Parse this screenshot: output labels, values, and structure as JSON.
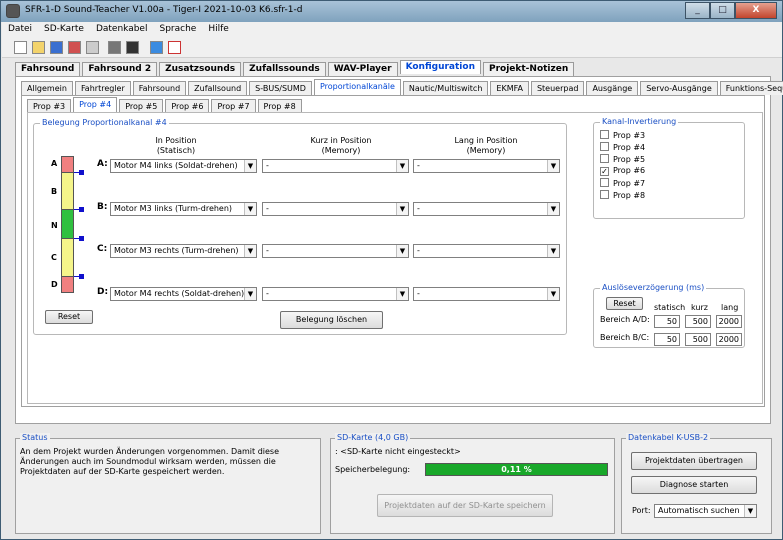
{
  "window": {
    "title": "SFR-1-D Sound-Teacher V1.00a - Tiger-I 2021-10-03 K6.sfr-1-d",
    "controls": [
      "_",
      "□",
      "X"
    ]
  },
  "menu": [
    "Datei",
    "SD-Karte",
    "Datenkabel",
    "Sprache",
    "Hilfe"
  ],
  "main_tabs": [
    "Fahrsound",
    "Fahrsound 2",
    "Zusatzsounds",
    "Zufallssounds",
    "WAV-Player",
    "Konfiguration",
    "Projekt-Notizen"
  ],
  "main_tab_selected": 5,
  "sub_tabs": [
    "Allgemein",
    "Fahrtregler",
    "Fahrsound",
    "Zufallsound",
    "S-BUS/SUMD",
    "Proportionalkanäle",
    "Nautic/Multiswitch",
    "EKMFA",
    "Steuerpad",
    "Ausgänge",
    "Servo-Ausgänge",
    "Funktions-Sequenzen"
  ],
  "sub_tab_selected": 5,
  "prop_tabs": [
    "Prop #3",
    "Prop #4",
    "Prop #5",
    "Prop #6",
    "Prop #7",
    "Prop #8"
  ],
  "prop_tab_selected": 1,
  "belegung": {
    "title": "Belegung Proportionalkanal #4",
    "col_in_position": [
      "In Position",
      "(Statisch)"
    ],
    "col_kurz": [
      "Kurz in Position",
      "(Memory)"
    ],
    "col_lang": [
      "Lang in Position",
      "(Memory)"
    ],
    "rows": [
      {
        "label": "A:",
        "in_position": "Motor M4 links (Soldat-drehen)",
        "kurz": "-",
        "lang": "-"
      },
      {
        "label": "B:",
        "in_position": "Motor M3 links (Turm-drehen)",
        "kurz": "-",
        "lang": "-"
      },
      {
        "label": "C:",
        "in_position": "Motor M3 rechts (Turm-drehen)",
        "kurz": "-",
        "lang": "-"
      },
      {
        "label": "D:",
        "in_position": "Motor M4 rechts (Soldat-drehen)",
        "kurz": "-",
        "lang": "-"
      }
    ],
    "diagram_labels": [
      "A",
      "B",
      "N",
      "C",
      "D"
    ],
    "reset_label": "Reset",
    "clear_label": "Belegung löschen",
    "colors": {
      "red": "#f08080",
      "yellow": "#f5f58a",
      "green": "#30c040",
      "blue": "#1010cc"
    }
  },
  "kanal_invertierung": {
    "title": "Kanal-Invertierung",
    "items": [
      {
        "label": "Prop #3",
        "checked": false
      },
      {
        "label": "Prop #4",
        "checked": false
      },
      {
        "label": "Prop #5",
        "checked": false
      },
      {
        "label": "Prop #6",
        "checked": true
      },
      {
        "label": "Prop #7",
        "checked": false
      },
      {
        "label": "Prop #8",
        "checked": false
      }
    ],
    "check_mark": "✓"
  },
  "ausloese": {
    "title": "Auslöseverzögerung (ms)",
    "reset_label": "Reset",
    "headers": [
      "statisch",
      "kurz",
      "lang"
    ],
    "rows": [
      {
        "label": "Bereich A/D:",
        "values": [
          "50",
          "500",
          "2000"
        ]
      },
      {
        "label": "Bereich B/C:",
        "values": [
          "50",
          "500",
          "2000"
        ]
      }
    ]
  },
  "status": {
    "title": "Status",
    "text": "An dem Projekt wurden Änderungen vorgenommen. Damit diese Änderungen auch im Soundmodul wirksam werden, müssen die Projektdaten auf der SD-Karte gespeichert werden."
  },
  "sd_karte": {
    "title": "SD-Karte (4,0 GB)",
    "state": ": <SD-Karte nicht eingesteckt>",
    "usage_label": "Speicherbelegung:",
    "usage_value": "0,11 %",
    "save_label": "Projektdaten auf der SD-Karte speichern"
  },
  "datenkabel": {
    "title": "Datenkabel K-USB-2",
    "transfer_label": "Projektdaten übertragen",
    "diagnose_label": "Diagnose starten",
    "port_label": "Port:",
    "port_value": "Automatisch suchen"
  }
}
